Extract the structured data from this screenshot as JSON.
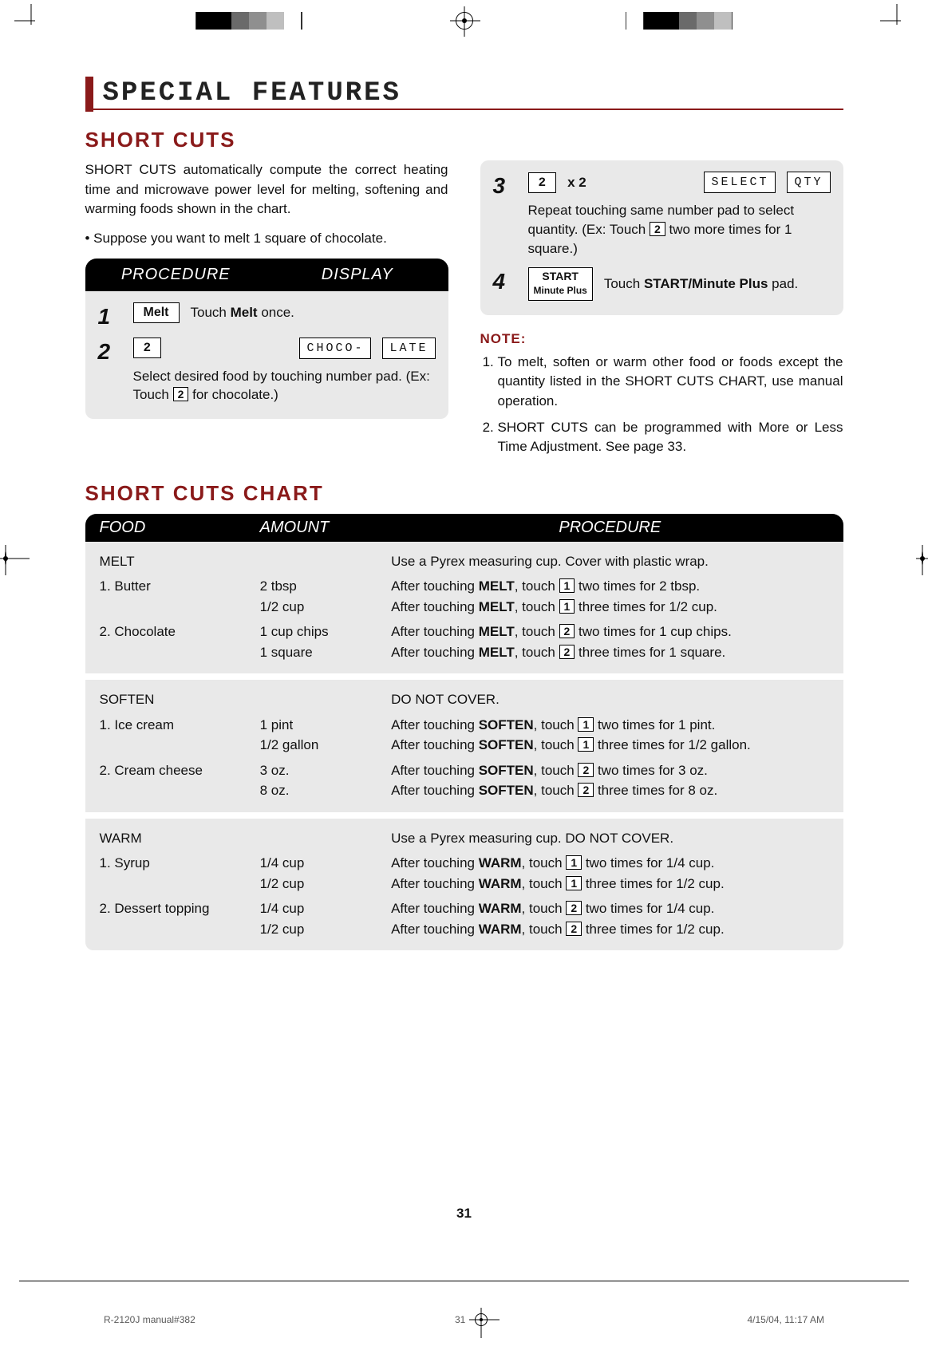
{
  "chapter_title": "SPECIAL FEATURES",
  "section_title": "SHORT CUTS",
  "intro_p1": "SHORT CUTS automatically compute the correct heating time and microwave power level for melting, softening and warming foods shown in the chart.",
  "intro_p2": "• Suppose you want to melt 1 square of chocolate.",
  "procedure_hdr": "PROCEDURE",
  "display_hdr": "DISPLAY",
  "steps": {
    "s1": {
      "num": "1",
      "key": "Melt",
      "text_before": "Touch ",
      "text_strong": "Melt",
      "text_after": " once."
    },
    "s2": {
      "num": "2",
      "key": "2",
      "lcd1": "CHOCO-",
      "lcd2": "LATE",
      "sub_before": "Select desired food by touching number pad. (Ex: Touch ",
      "sub_key": "2",
      "sub_after": " for chocolate.)"
    },
    "s3": {
      "num": "3",
      "key": "2",
      "mult": "x 2",
      "lcd1": "SELECT",
      "lcd2": "QTY",
      "sub_before": "Repeat touching same number pad to select quantity. (Ex: Touch ",
      "sub_key": "2",
      "sub_after": " two more times for 1 square.)"
    },
    "s4": {
      "num": "4",
      "key_l1": "START",
      "key_l2": "Minute Plus",
      "text_before": "Touch ",
      "text_strong": "START/Minute Plus",
      "text_after": " pad."
    }
  },
  "note_label": "NOTE:",
  "notes": {
    "n1": "To melt, soften or warm other food or foods except the quantity listed in the SHORT CUTS CHART, use manual operation.",
    "n2": "SHORT CUTS can be programmed with More or Less Time Adjustment. See page 33."
  },
  "chart_title": "SHORT CUTS CHART",
  "chart_hdr": {
    "food": "FOOD",
    "amount": "AMOUNT",
    "procedure": "PROCEDURE"
  },
  "chart": {
    "melt": {
      "name": "MELT",
      "tip": "Use a Pyrex measuring cup. Cover with plastic wrap.",
      "rows": {
        "r1": {
          "food": "1. Butter",
          "amount": "2 tbsp\n1/2 cup",
          "proc_a_before": "After touching ",
          "proc_a_strong": "MELT",
          "proc_a_mid": ", touch ",
          "proc_a_key": "1",
          "proc_a_after": " two times for 2 tbsp.",
          "proc_b_before": "After touching ",
          "proc_b_strong": "MELT",
          "proc_b_mid": ", touch ",
          "proc_b_key": "1",
          "proc_b_after": " three times for 1/2 cup."
        },
        "r2": {
          "food": "2. Chocolate",
          "amount": "1 cup chips\n1 square",
          "proc_a_before": "After touching ",
          "proc_a_strong": "MELT",
          "proc_a_mid": ", touch ",
          "proc_a_key": "2",
          "proc_a_after": " two times for 1 cup chips.",
          "proc_b_before": "After touching ",
          "proc_b_strong": "MELT",
          "proc_b_mid": ", touch ",
          "proc_b_key": "2",
          "proc_b_after": " three times for 1 square."
        }
      }
    },
    "soften": {
      "name": "SOFTEN",
      "tip": "DO NOT COVER.",
      "rows": {
        "r1": {
          "food": "1. Ice cream",
          "amount": "1 pint\n1/2 gallon",
          "proc_a_before": "After touching ",
          "proc_a_strong": "SOFTEN",
          "proc_a_mid": ", touch ",
          "proc_a_key": "1",
          "proc_a_after": " two times for 1 pint.",
          "proc_b_before": "After touching ",
          "proc_b_strong": "SOFTEN",
          "proc_b_mid": ", touch ",
          "proc_b_key": "1",
          "proc_b_after": " three times for 1/2 gallon."
        },
        "r2": {
          "food": "2. Cream cheese",
          "amount": "3 oz.\n8 oz.",
          "proc_a_before": "After touching ",
          "proc_a_strong": "SOFTEN",
          "proc_a_mid": ", touch ",
          "proc_a_key": "2",
          "proc_a_after": " two times for 3 oz.",
          "proc_b_before": "After touching ",
          "proc_b_strong": "SOFTEN",
          "proc_b_mid": ", touch ",
          "proc_b_key": "2",
          "proc_b_after": " three times for 8 oz."
        }
      }
    },
    "warm": {
      "name": "WARM",
      "tip": "Use a Pyrex measuring cup. DO NOT COVER.",
      "rows": {
        "r1": {
          "food": "1. Syrup",
          "amount": "1/4 cup\n1/2 cup",
          "proc_a_before": "After touching ",
          "proc_a_strong": "WARM",
          "proc_a_mid": ", touch ",
          "proc_a_key": "1",
          "proc_a_after": " two times for 1/4 cup.",
          "proc_b_before": "After touching ",
          "proc_b_strong": "WARM",
          "proc_b_mid": ", touch ",
          "proc_b_key": "1",
          "proc_b_after": " three times for 1/2 cup."
        },
        "r2": {
          "food": "2. Dessert topping",
          "amount": "1/4 cup\n1/2 cup",
          "proc_a_before": "After touching ",
          "proc_a_strong": "WARM",
          "proc_a_mid": ", touch ",
          "proc_a_key": "2",
          "proc_a_after": " two times for 1/4 cup.",
          "proc_b_before": "After touching ",
          "proc_b_strong": "WARM",
          "proc_b_mid": ", touch ",
          "proc_b_key": "2",
          "proc_b_after": " three times for 1/2 cup."
        }
      }
    }
  },
  "page_number": "31",
  "footer": {
    "left": "R-2120J manual#382",
    "center": "31",
    "right": "4/15/04, 11:17 AM"
  }
}
